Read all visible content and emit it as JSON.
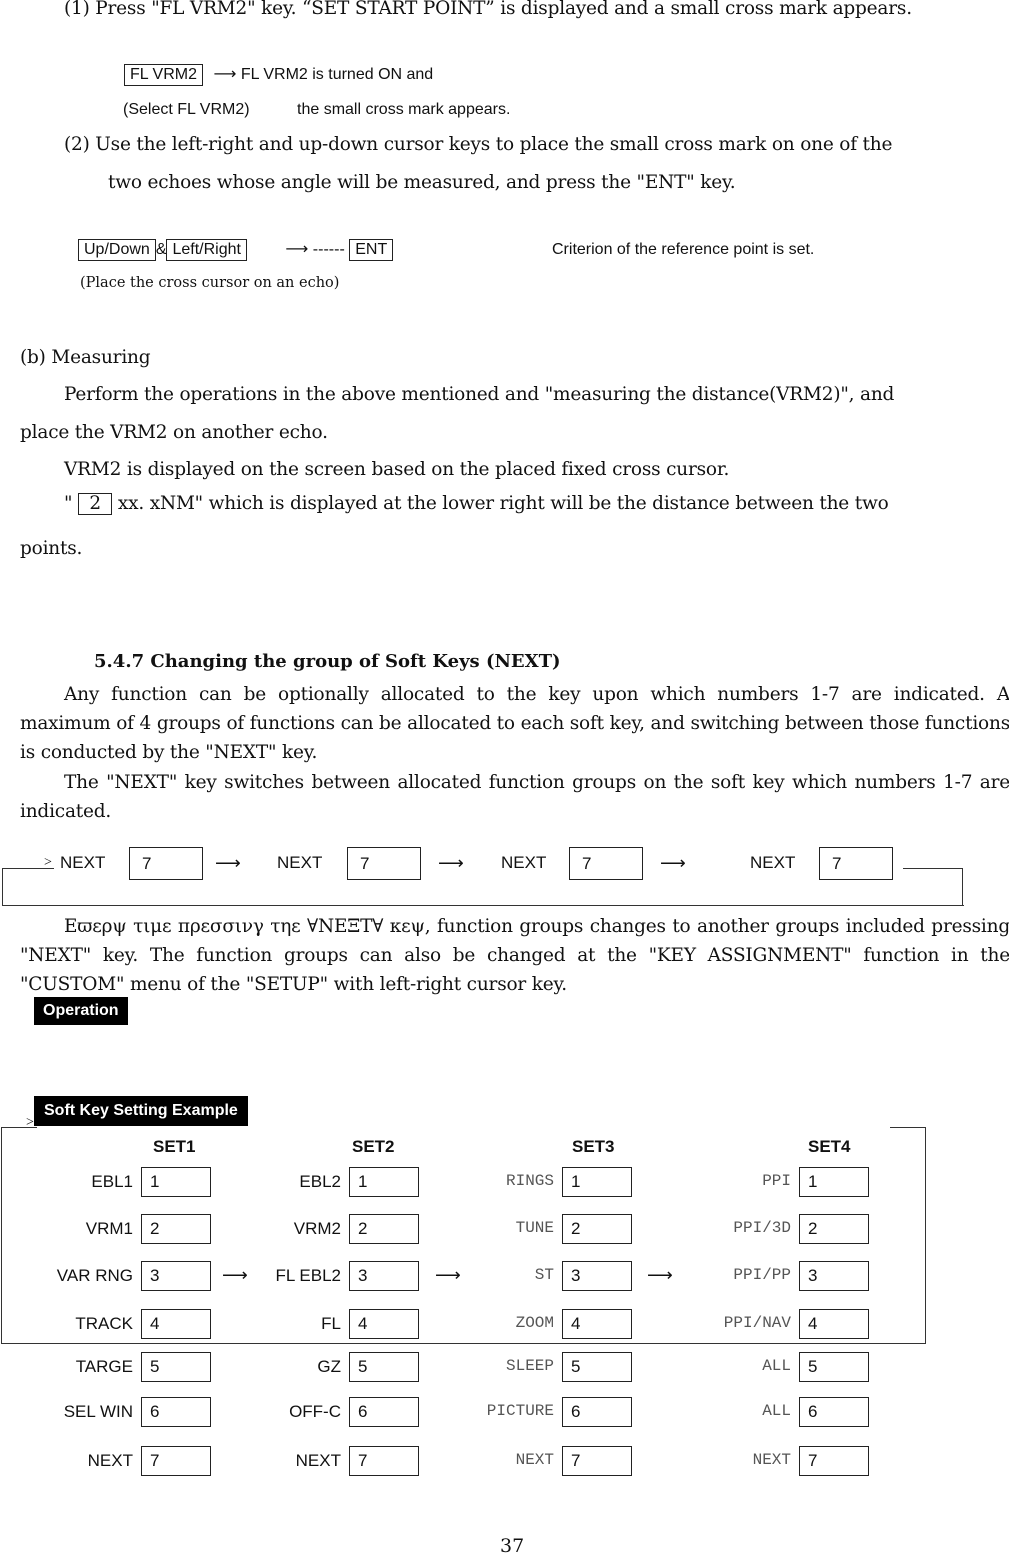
{
  "step1": {
    "text": "(1)  Press \"FL VRM2\" key. “SET START POINT” is displayed and a small cross mark appears.",
    "key": "FL VRM2",
    "arrow": "⟶",
    "result": "FL VRM2 is turned ON and",
    "note": "(Select FL VRM2)",
    "result2": "the small cross mark appears."
  },
  "step2": {
    "line1": "(2)  Use the left-right and up-down cursor keys to place the small cross mark on one of the",
    "line2": "two echoes whose angle will be measured, and press the \"ENT\" key.",
    "key1": "Up/Down",
    "amp": "&",
    "key2": "Left/Right",
    "arrow": "⟶  ------",
    "key3": "ENT",
    "result": "Criterion of the reference point is set.",
    "note": "(Place the cross cursor on an echo)"
  },
  "measuring": {
    "heading": "(b)  Measuring",
    "line1": "Perform the operations in the above mentioned and \"measuring the distance(VRM2)\", and",
    "line2": "place the VRM2  on another echo.",
    "line3": "VRM2 is displayed on the screen based on the placed fixed cross cursor.",
    "line4_prefix": "\"",
    "line4_key": "2",
    "line4_suffix": "xx. xNM\" which is displayed at the lower right will be the distance between the two",
    "line5": "points."
  },
  "section": {
    "title": "5.4.7 Changing the group of Soft Keys (NEXT)",
    "para1": "Any function can be optionally allocated to the key upon which numbers 1-7 are indicated. A maximum of 4 groups of functions can be allocated to each soft key, and switching between those functions is conducted by the \"NEXT\" key.",
    "para2": "The \"NEXT\" key switches between allocated function groups on the soft key which numbers 1-7 are indicated.",
    "para3": "Eϖερψ τιμε πρεσσινγ τηε ∀ΝΕΞΤ∀ κεψ, function groups changes to another groups included pressing  \"NEXT\" key. The function groups can also be changed at the \"KEY ASSIGNMENT\" function in the \"CUSTOM\" menu of the \"SETUP\" with left-right cursor key."
  },
  "next_flow": [
    {
      "label": "NEXT",
      "key": "7"
    },
    {
      "label": "NEXT",
      "key": "7"
    },
    {
      "label": "NEXT",
      "key": "7"
    },
    {
      "label": "NEXT",
      "key": "7"
    }
  ],
  "operation_tag": "Operation",
  "example": {
    "title": "Soft Key Setting Example",
    "sets": [
      {
        "name": "SET1",
        "items": [
          {
            "label": "EBL1",
            "key": "1"
          },
          {
            "label": "VRM1",
            "key": "2"
          },
          {
            "label": "VAR RNG",
            "key": "3"
          },
          {
            "label": "TRACK",
            "key": "4"
          },
          {
            "label": "TARGE",
            "key": "5"
          },
          {
            "label": "SEL WIN",
            "key": "6"
          },
          {
            "label": "NEXT",
            "key": "7"
          }
        ]
      },
      {
        "name": "SET2",
        "items": [
          {
            "label": "EBL2",
            "key": "1"
          },
          {
            "label": "VRM2",
            "key": "2"
          },
          {
            "label": "FL EBL2",
            "key": "3"
          },
          {
            "label": "FL",
            "key": "4"
          },
          {
            "label": "GZ",
            "key": "5"
          },
          {
            "label": "OFF-C",
            "key": "6"
          },
          {
            "label": "NEXT",
            "key": "7"
          }
        ]
      },
      {
        "name": "SET3",
        "items": [
          {
            "label": "RINGS",
            "key": "1"
          },
          {
            "label": "TUNE",
            "key": "2"
          },
          {
            "label": "ST",
            "key": "3"
          },
          {
            "label": "ZOOM",
            "key": "4"
          },
          {
            "label": "SLEEP",
            "key": "5"
          },
          {
            "label": "PICTURE",
            "key": "6"
          },
          {
            "label": "NEXT",
            "key": "7"
          }
        ]
      },
      {
        "name": "SET4",
        "items": [
          {
            "label": "PPI",
            "key": "1"
          },
          {
            "label": "PPI/3D",
            "key": "2"
          },
          {
            "label": "PPI/PP",
            "key": "3"
          },
          {
            "label": "PPI/NAV",
            "key": "4"
          },
          {
            "label": "ALL",
            "key": "5"
          },
          {
            "label": "ALL",
            "key": "6"
          },
          {
            "label": "NEXT",
            "key": "7"
          }
        ]
      }
    ]
  },
  "page_number": "37"
}
